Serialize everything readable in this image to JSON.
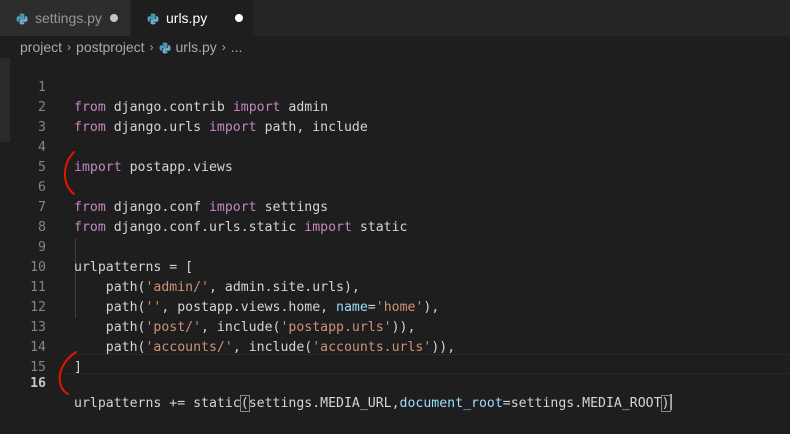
{
  "tabs": [
    {
      "label": "settings.py",
      "active": false,
      "modified": true
    },
    {
      "label": "urls.py",
      "active": true,
      "modified": true
    }
  ],
  "breadcrumb": {
    "items": [
      "project",
      "postproject",
      "urls.py",
      "..."
    ]
  },
  "editor": {
    "current_line": 16,
    "line_numbers": [
      "1",
      "2",
      "3",
      "4",
      "5",
      "6",
      "7",
      "8",
      "9",
      "10",
      "11",
      "12",
      "13",
      "14",
      "15",
      "16"
    ],
    "lines": {
      "l1": {
        "kw1": "from",
        "mod": " django.contrib ",
        "kw2": "import",
        "rest": " admin"
      },
      "l2": {
        "kw1": "from",
        "mod": " django.urls ",
        "kw2": "import",
        "rest": " path, include"
      },
      "l4": {
        "kw1": "import",
        "rest": " postapp.views"
      },
      "l6": {
        "kw1": "from",
        "mod": " django.conf ",
        "kw2": "import",
        "rest": " settings"
      },
      "l7": {
        "kw1": "from",
        "mod": " django.conf.urls.static ",
        "kw2": "import",
        "rest": " static"
      },
      "l9": {
        "text": "urlpatterns = ["
      },
      "l10": {
        "a": "    path(",
        "s1": "'admin/'",
        "b": ", admin.site.urls),"
      },
      "l11": {
        "a": "    path(",
        "s1": "''",
        "b": ", postapp.views.home, ",
        "p": "name",
        "eq": "=",
        "s2": "'home'",
        "c": "),"
      },
      "l12": {
        "a": "    path(",
        "s1": "'post/'",
        "b": ", include(",
        "s2": "'postapp.urls'",
        "c": ")),"
      },
      "l13": {
        "a": "    path(",
        "s1": "'accounts/'",
        "b": ", include(",
        "s2": "'accounts.urls'",
        "c": ")),"
      },
      "l14": {
        "text": "]"
      },
      "l16": {
        "a": "urlpatterns += static",
        "open": "(",
        "b": "settings.MEDIA_URL,",
        "p": "document_root",
        "c": "=settings.MEDIA_ROOT",
        "close": ")"
      }
    }
  },
  "colors": {
    "keyword": "#c586c0",
    "string": "#ce9178",
    "parameter": "#9cdcfe",
    "annotation": "#e51400"
  }
}
